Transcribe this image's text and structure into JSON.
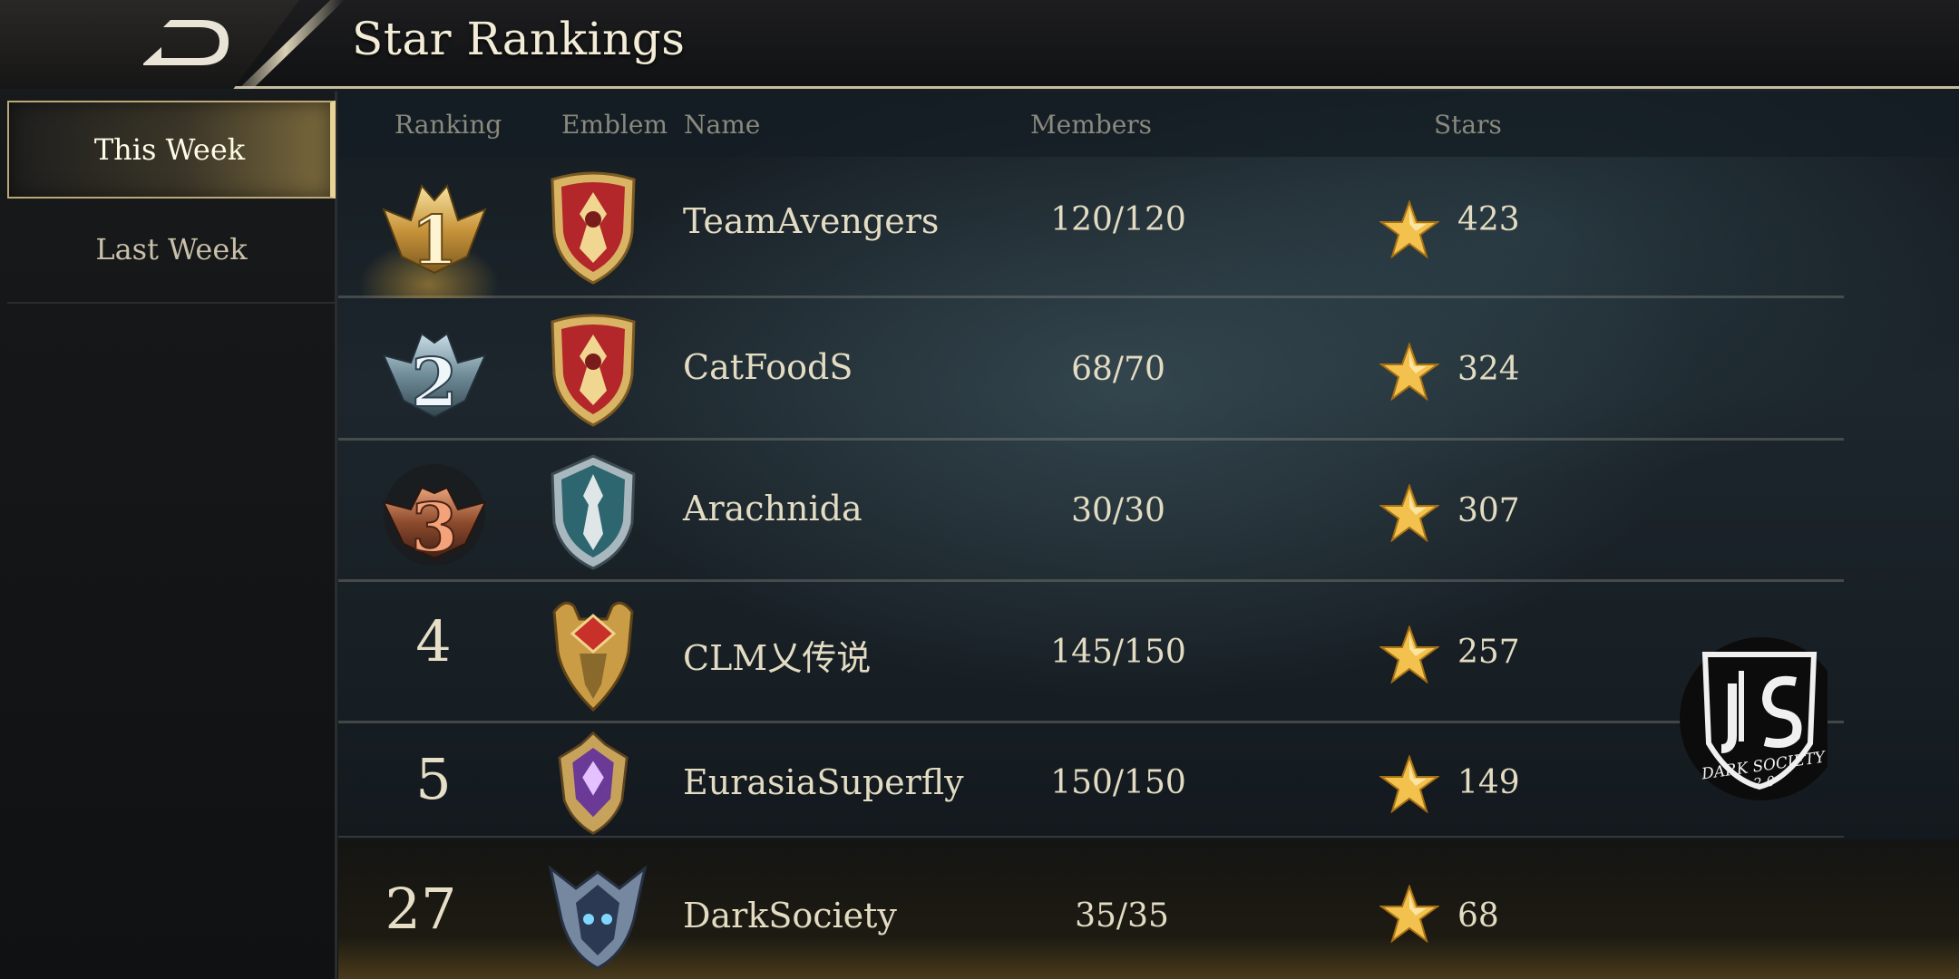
{
  "header": {
    "title": "Star Rankings",
    "back_icon": "back-arrow-icon"
  },
  "sidebar": {
    "tabs": [
      {
        "label": "This Week",
        "active": true
      },
      {
        "label": "Last Week",
        "active": false
      }
    ]
  },
  "table": {
    "columns": {
      "ranking": "Ranking",
      "emblem": "Emblem",
      "name": "Name",
      "members": "Members",
      "stars": "Stars"
    },
    "rows": [
      {
        "rank": "1",
        "name": "TeamAvengers",
        "members": "120/120",
        "stars": "423",
        "badge": "gold-rank-badge",
        "emblem": "red-gold-shield-emblem"
      },
      {
        "rank": "2",
        "name": "CatFoodS",
        "members": "68/70",
        "stars": "324",
        "badge": "silver-rank-badge",
        "emblem": "red-gold-shield-emblem"
      },
      {
        "rank": "3",
        "name": "Arachnida",
        "members": "30/30",
        "stars": "307",
        "badge": "bronze-rank-badge",
        "emblem": "teal-silver-shield-emblem"
      },
      {
        "rank": "4",
        "name": "CLM乂传说",
        "members": "145/150",
        "stars": "257",
        "emblem": "gold-ruby-emblem"
      },
      {
        "rank": "5",
        "name": "EurasiaSuperfly",
        "members": "150/150",
        "stars": "149",
        "emblem": "purple-gem-emblem"
      }
    ],
    "own_row": {
      "rank": "27",
      "name": "DarkSociety",
      "members": "35/35",
      "stars": "68",
      "emblem": "horned-demon-emblem"
    }
  },
  "watermark": {
    "line1": "DARK SOCIETY",
    "line2": "2.0",
    "icon": "dark-society-logo"
  },
  "colors": {
    "accent_gold": "#e8d397",
    "text": "#e3dcc3",
    "header_text": "#8a897d",
    "star": "#f2c14e"
  }
}
